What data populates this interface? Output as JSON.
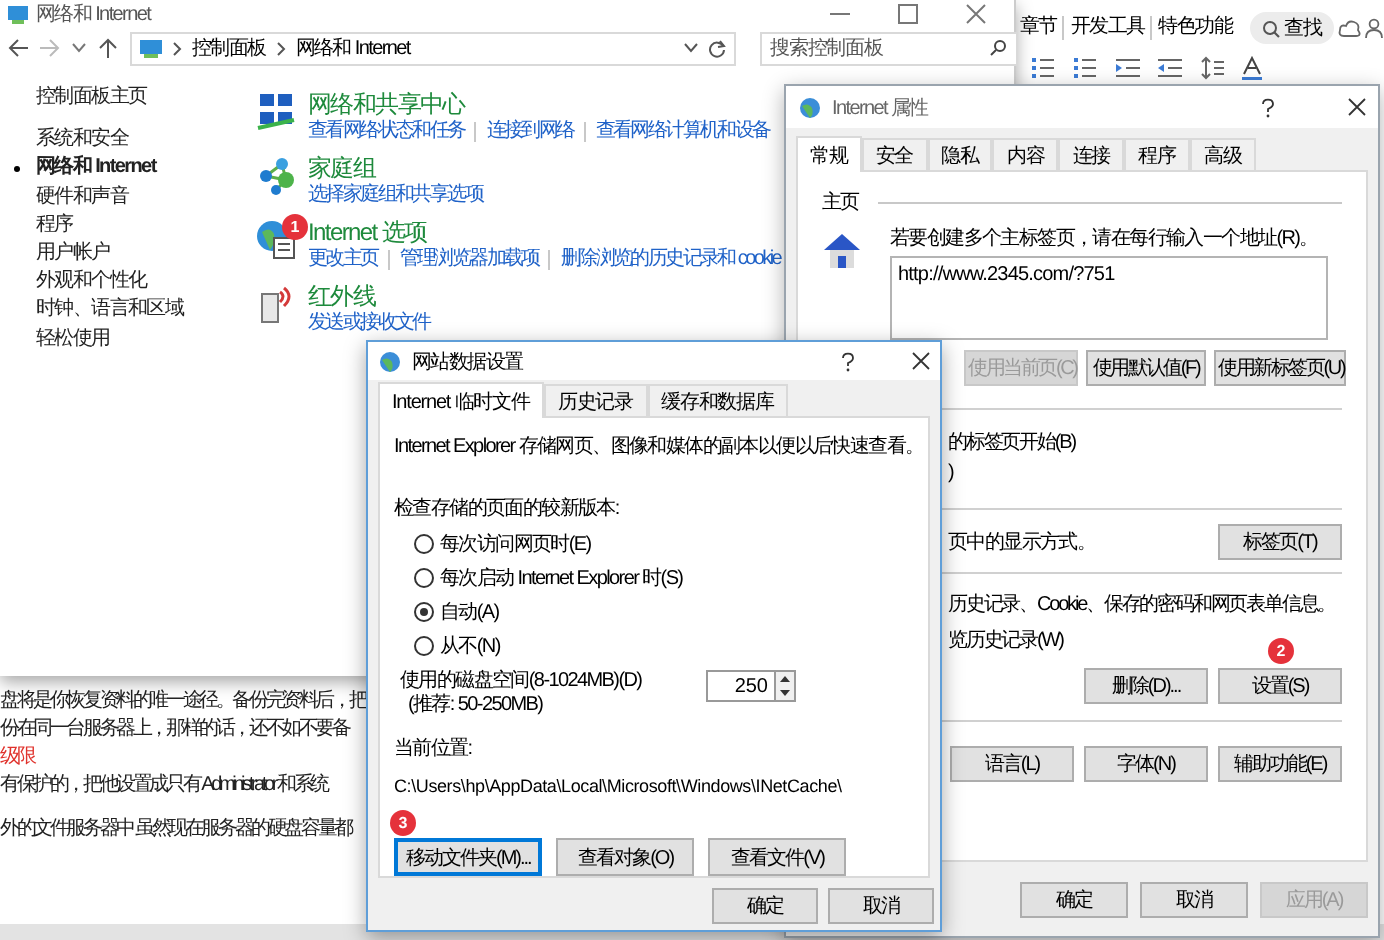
{
  "word": {
    "ribbon_tabs": [
      "章节",
      "开发工具",
      "特色功能"
    ],
    "search_button": "查找",
    "blocks": [
      {
        "kind": "text",
        "lines": [
          "盘将是你恢复资料的唯一途径。备份完资料后，把",
          "份在同一台服务器上，那样的话，还不如不要备"
        ]
      },
      {
        "kind": "heading",
        "lines": [
          "级限"
        ]
      },
      {
        "kind": "text",
        "lines": [
          "有保护的，把他设置成只有 Administrator 和系统"
        ]
      },
      {
        "kind": "text",
        "lines": [
          "外的文件服务器中 虽然现在服务器的硬盘容量都"
        ]
      }
    ]
  },
  "control_panel": {
    "title": "网络和 Internet",
    "breadcrumb": [
      "控制面板",
      "网络和 Internet"
    ],
    "search": {
      "placeholder": "搜索控制面板"
    },
    "sidebar": [
      {
        "label": "控制面板主页",
        "selected": false
      },
      {
        "label": "系统和安全",
        "selected": false
      },
      {
        "label": "网络和 Internet",
        "selected": true
      },
      {
        "label": "硬件和声音",
        "selected": false
      },
      {
        "label": "程序",
        "selected": false
      },
      {
        "label": "用户帐户",
        "selected": false
      },
      {
        "label": "外观和个性化",
        "selected": false
      },
      {
        "label": "时钟、语言和区域",
        "selected": false
      },
      {
        "label": "轻松使用",
        "selected": false
      }
    ],
    "categories": [
      {
        "kind": "network",
        "title": "网络和共享中心",
        "links": [
          "查看网络状态和任务",
          "连接到网络",
          "查看网络计算机和设备"
        ]
      },
      {
        "kind": "homegroup",
        "title": "家庭组",
        "links": [
          "选择家庭组和共享选项"
        ]
      },
      {
        "kind": "internet",
        "title": "Internet 选项",
        "badge": "1",
        "links": [
          "更改主页",
          "管理浏览器加载项",
          "删除浏览的历史记录和 cookie"
        ]
      },
      {
        "kind": "infrared",
        "title": "红外线",
        "links": [
          "发送或接收文件"
        ]
      }
    ]
  },
  "internet_properties": {
    "title": "Internet 属性",
    "tabs": [
      {
        "label": "常规",
        "selected": true
      },
      {
        "label": "安全",
        "selected": false
      },
      {
        "label": "隐私",
        "selected": false
      },
      {
        "label": "内容",
        "selected": false
      },
      {
        "label": "连接",
        "selected": false
      },
      {
        "label": "程序",
        "selected": false
      },
      {
        "label": "高级",
        "selected": false
      }
    ],
    "home_page": {
      "heading": "主页",
      "instruction": "若要创建多个主标签页，请在每行输入一个地址(R)。",
      "value": "http://www.2345.com/?751",
      "buttons": [
        {
          "label": "使用当前页(C)",
          "disabled": true
        },
        {
          "label": "使用默认值(F)",
          "disabled": false
        },
        {
          "label": "使用新标签页(U)",
          "disabled": false
        }
      ]
    },
    "startup_fragments": [
      "的标签页开始(B)",
      ")"
    ],
    "tabs_section": {
      "text": "页中的显示方式。",
      "button": "标签页(T)"
    },
    "history": {
      "text": "历史记录、Cookie、保存的密码和网页表单信息。",
      "option": "览历史记录(W)",
      "buttons": [
        {
          "label": "删除(D)..."
        },
        {
          "label": "设置(S)",
          "badge": "2"
        }
      ]
    },
    "appearance_buttons": [
      "语言(L)",
      "字体(N)",
      "辅助功能(E)"
    ],
    "footer": [
      {
        "label": "确定",
        "disabled": false
      },
      {
        "label": "取消",
        "disabled": false
      },
      {
        "label": "应用(A)",
        "disabled": true
      }
    ]
  },
  "website_data": {
    "title": "网站数据设置",
    "tabs": [
      {
        "label": "Internet 临时文件",
        "selected": true
      },
      {
        "label": "历史记录",
        "selected": false
      },
      {
        "label": "缓存和数据库",
        "selected": false
      }
    ],
    "description": "Internet Explorer 存储网页、图像和媒体的副本以便以后快速查看。",
    "check_label": "检查存储的页面的较新版本:",
    "options": [
      {
        "label": "每次访问网页时(E)",
        "selected": false
      },
      {
        "label": "每次启动 Internet Explorer 时(S)",
        "selected": false
      },
      {
        "label": "自动(A)",
        "selected": true
      },
      {
        "label": "从不(N)",
        "selected": false
      }
    ],
    "disk_label": "使用的磁盘空间(8-1024MB)(D)",
    "disk_hint": "(推荐: 50-250MB)",
    "disk_value": "250",
    "location_label": "当前位置:",
    "location": "C:\\Users\\hp\\AppData\\Local\\Microsoft\\Windows\\INetCache\\",
    "actions": [
      {
        "label": "移动文件夹(M)...",
        "badge": "3",
        "focused": true
      },
      {
        "label": "查看对象(O)",
        "focused": false
      },
      {
        "label": "查看文件(V)",
        "focused": false
      }
    ],
    "footer": [
      "确定",
      "取消"
    ]
  }
}
